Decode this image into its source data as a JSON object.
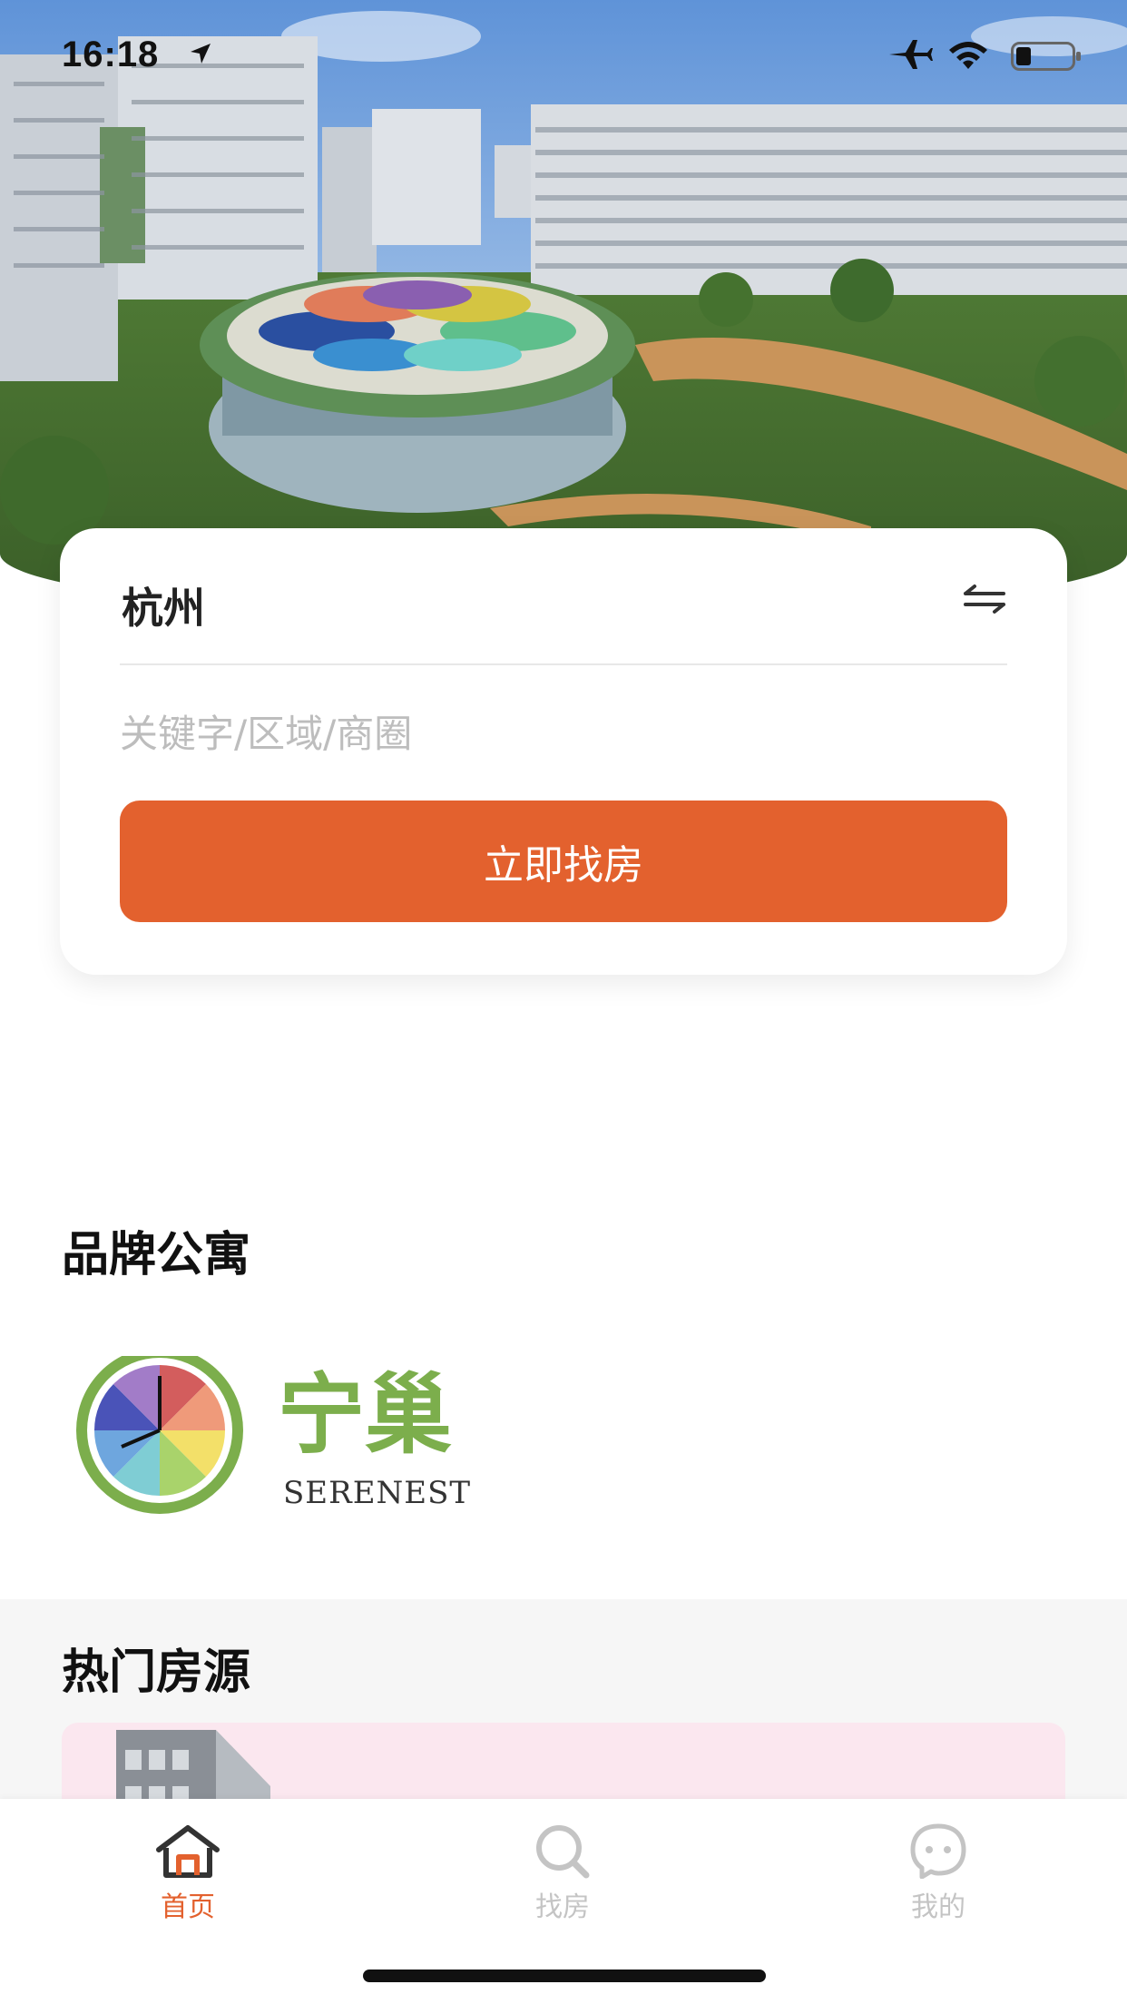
{
  "status_bar": {
    "time": "16:18"
  },
  "search_card": {
    "city": "杭州",
    "keyword_placeholder": "关键字/区域/商圈",
    "find_button_label": "立即找房"
  },
  "brand_section": {
    "title": "品牌公寓",
    "logo_text": "宁巢",
    "logo_subtext": "SERENEST"
  },
  "hot_section": {
    "title": "热门房源"
  },
  "tabbar": {
    "items": [
      {
        "label": "首页",
        "icon": "home-icon",
        "active": true
      },
      {
        "label": "找房",
        "icon": "search-icon",
        "active": false
      },
      {
        "label": "我的",
        "icon": "profile-icon",
        "active": false
      }
    ]
  },
  "colors": {
    "accent": "#e3612e",
    "inactive_tab": "#c4c4c4",
    "brand_green": "#7cae4c",
    "hot_card_bg": "#fbe7ef"
  }
}
